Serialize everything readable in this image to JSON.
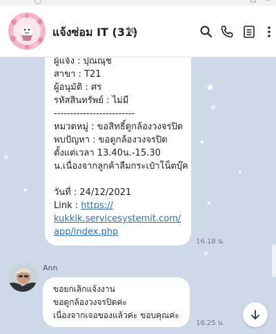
{
  "colors": {
    "chat_background": "#cdd9e8",
    "bubble": "#ffffff",
    "link": "#2a6fbb",
    "header": "#ffffff"
  },
  "header": {
    "title": "แจ้งซ่อม IT (31)",
    "icons": [
      "search-icon",
      "phone-icon",
      "notes-icon",
      "more-icon",
      "mute-icon"
    ]
  },
  "messages": [
    {
      "lines": [
        "ผู้แจ้ง : ปุณณุช",
        "สาขา : T21",
        "ผู้อนุมัติ : ศร",
        "รหัสสินทรัพย์ : ไม่มี",
        "-------------------------",
        "หมวดหมู่ : ขอสิทธิ์ดูกล้องวงจรปิด",
        "พบปัญหา : ขอดูกล้องวงจรปิด",
        "ตั้งแต่เวลา 13.40น.-15.30",
        "น.เนื่องจากลูกค้าลืมกระเป๋าโน็ตบุ๊ค"
      ],
      "date_line": "วันที่ : 24/12/2021",
      "link_label": "Link : ",
      "link_lines": [
        "https://",
        "kukkik.servicesystemit.com/",
        "app/index.php"
      ],
      "time": "16.18 น."
    },
    {
      "sender": "Ann",
      "lines": [
        "ขอยกเลิกแจ้งงาน",
        "ขอดูกล้องวงจรปิดค่ะ",
        "เนื่องจากเจอของแล้วค่ะ ขอบคุณค่ะ"
      ],
      "time": "16.25 น."
    }
  ]
}
